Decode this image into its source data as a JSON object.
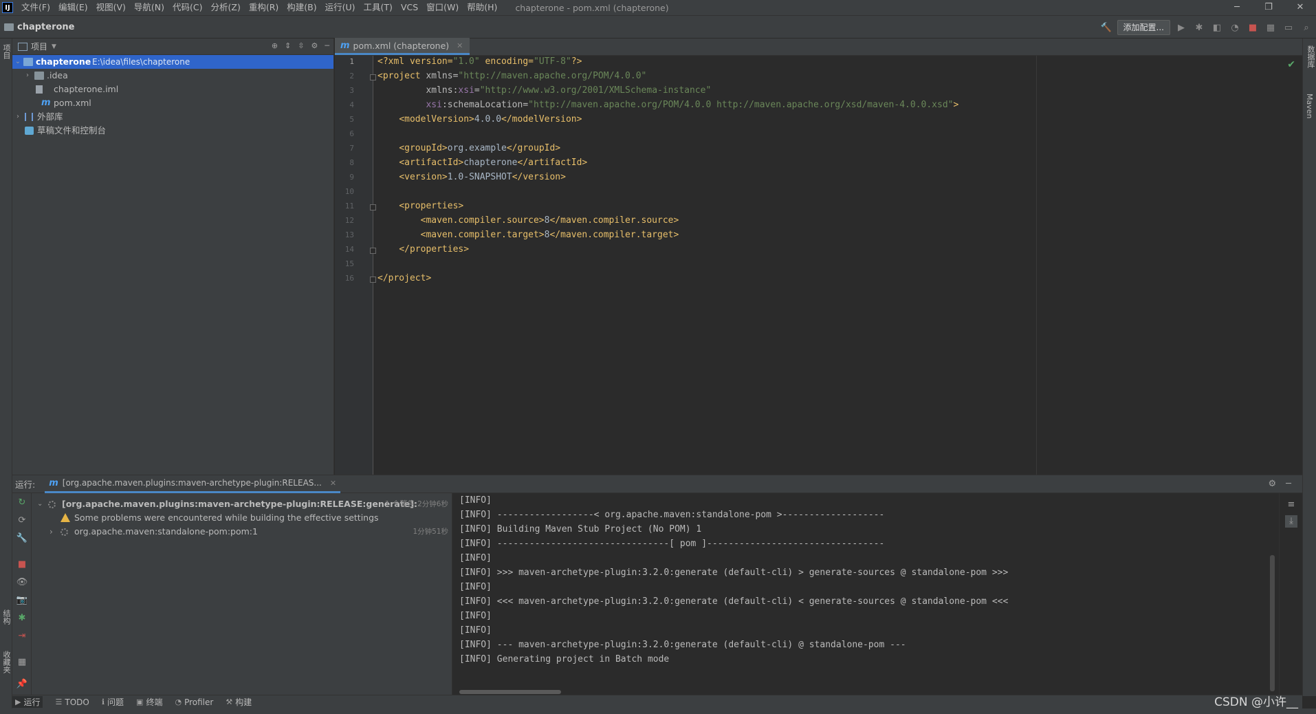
{
  "menubar": {
    "logo": "IJ",
    "items": [
      "文件(F)",
      "编辑(E)",
      "视图(V)",
      "导航(N)",
      "代码(C)",
      "分析(Z)",
      "重构(R)",
      "构建(B)",
      "运行(U)",
      "工具(T)",
      "VCS",
      "窗口(W)",
      "帮助(H)"
    ],
    "window_title": "chapterone - pom.xml (chapterone)",
    "controls": [
      "─",
      "❐",
      "✕"
    ]
  },
  "navbar": {
    "project": "chapterone",
    "add_config_label": "添加配置..."
  },
  "left_strip": {
    "project_label": "项目",
    "structure_label": "结构",
    "favorites_label": "收藏夹"
  },
  "right_strip": {
    "database_label": "数据库",
    "maven_label": "Maven"
  },
  "project_panel": {
    "title": "项目",
    "tree": [
      {
        "label": "chapterone",
        "path": "E:\\idea\\files\\chapterone"
      },
      {
        "label": ".idea"
      },
      {
        "label": "chapterone.iml"
      },
      {
        "label": "pom.xml"
      },
      {
        "label": "外部库"
      },
      {
        "label": "草稿文件和控制台"
      }
    ]
  },
  "editor": {
    "tab_label": "pom.xml (chapterone)",
    "line_numbers": [
      "1",
      "2",
      "3",
      "4",
      "5",
      "6",
      "7",
      "8",
      "9",
      "10",
      "11",
      "12",
      "13",
      "14",
      "15",
      "16"
    ],
    "code": {
      "l1": [
        "<?xml version=",
        "\"1.0\"",
        " encoding=",
        "\"UTF-8\"",
        "?>"
      ],
      "l2": [
        "<project ",
        "xmlns=",
        "\"http://maven.apache.org/POM/4.0.0\""
      ],
      "l3": [
        "         ",
        "xmlns:",
        "xsi",
        "=",
        "\"http://www.w3.org/2001/XMLSchema-instance\""
      ],
      "l4": [
        "         ",
        "xsi",
        ":schemaLocation=",
        "\"http://maven.apache.org/POM/4.0.0 http://maven.apache.org/xsd/maven-4.0.0.xsd\"",
        ">"
      ],
      "l5": [
        "    ",
        "<modelVersion>",
        "4.0.0",
        "</modelVersion>"
      ],
      "l7": [
        "    ",
        "<groupId>",
        "org.example",
        "</groupId>"
      ],
      "l8": [
        "    ",
        "<artifactId>",
        "chapterone",
        "</artifactId>"
      ],
      "l9": [
        "    ",
        "<version>",
        "1.0-SNAPSHOT",
        "</version>"
      ],
      "l11": [
        "    ",
        "<properties>"
      ],
      "l12": [
        "        ",
        "<maven.compiler.source>",
        "8",
        "</maven.compiler.source>"
      ],
      "l13": [
        "        ",
        "<maven.compiler.target>",
        "8",
        "</maven.compiler.target>"
      ],
      "l14": [
        "    ",
        "</properties>"
      ],
      "l16": [
        "</project>"
      ]
    }
  },
  "run_panel": {
    "label": "运行:",
    "tab_label": "[org.apache.maven.plugins:maven-archetype-plugin:RELEAS...",
    "tree": {
      "root_label": "[org.apache.maven.plugins:maven-archetype-plugin:RELEASE:generate]:",
      "root_warn": "1 个警告",
      "root_time": "2分钟6秒",
      "warning": "Some problems were encountered while building the effective settings",
      "child_label": "org.apache.maven:standalone-pom:pom:1",
      "child_time": "1分钟51秒"
    },
    "console": [
      "[INFO]",
      "[INFO] ------------------< org.apache.maven:standalone-pom >-------------------",
      "[INFO] Building Maven Stub Project (No POM) 1",
      "[INFO] --------------------------------[ pom ]---------------------------------",
      "[INFO]",
      "[INFO] >>> maven-archetype-plugin:3.2.0:generate (default-cli) > generate-sources @ standalone-pom >>>",
      "[INFO]",
      "[INFO] <<< maven-archetype-plugin:3.2.0:generate (default-cli) < generate-sources @ standalone-pom <<<",
      "[INFO]",
      "[INFO]",
      "[INFO] --- maven-archetype-plugin:3.2.0:generate (default-cli) @ standalone-pom ---",
      "[INFO] Generating project in Batch mode"
    ]
  },
  "bottom_bar": {
    "items": [
      "运行",
      "TODO",
      "问题",
      "终端",
      "Profiler",
      "构建"
    ]
  },
  "watermark": "CSDN @小许__",
  "colors": {
    "accent": "#2f65ca",
    "tab_underline": "#4a88c7",
    "tag": "#e8bf6a",
    "string": "#6a8759"
  }
}
